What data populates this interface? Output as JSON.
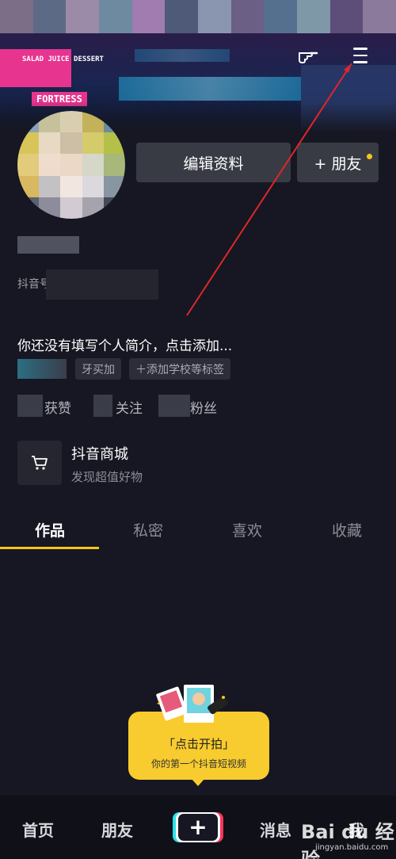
{
  "header": {
    "banner_signs": [
      "SALAD JUICE DESSERT",
      "FORTRESS"
    ],
    "icons": {
      "gesture": "pointing-hand-icon",
      "menu": "hamburger-menu-icon"
    }
  },
  "profile": {
    "edit_button_label": "编辑资料",
    "add_friend_label": "+ 朋友",
    "id_prefix": "抖音号",
    "bio_placeholder": "你还没有填写个人简介，点击添加...",
    "tags": {
      "age": "牙买加",
      "add_school": "＋添加学校等标签"
    },
    "stats": {
      "likes_label": "获赞",
      "following_label": "关注",
      "followers_label": "粉丝"
    }
  },
  "shop": {
    "title": "抖音商城",
    "subtitle": "发现超值好物",
    "icon": "shopping-cart-icon"
  },
  "tabs": [
    {
      "label": "作品",
      "active": true
    },
    {
      "label": "私密",
      "active": false
    },
    {
      "label": "喜欢",
      "active": false
    },
    {
      "label": "收藏",
      "active": false
    }
  ],
  "shoot_prompt": {
    "title": "「点击开拍」",
    "subtitle": "你的第一个抖音短视频"
  },
  "bottom_nav": {
    "home": "首页",
    "friends": "朋友",
    "add_symbol": "+",
    "messages": "消息",
    "me": "我"
  },
  "watermark": {
    "brand": "Bai du 经验",
    "url": "jingyan.baidu.com"
  },
  "colors": {
    "accent": "#f5c518",
    "background": "#161722",
    "button": "#393b44",
    "annotation": "#e0262b"
  }
}
